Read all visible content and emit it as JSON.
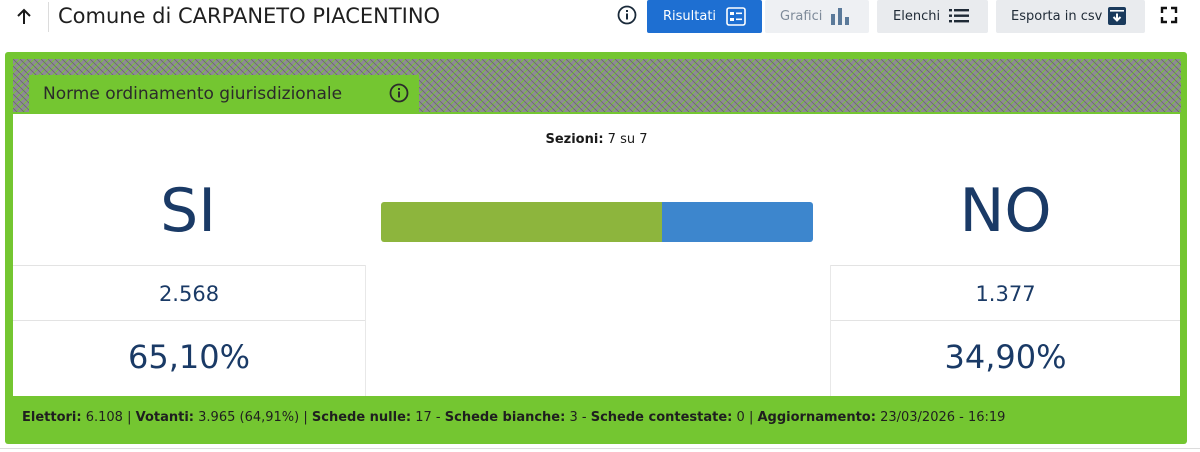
{
  "header": {
    "title": "Comune di CARPANETO PIACENTINO",
    "buttons": {
      "risultati": "Risultati",
      "grafici": "Grafici",
      "elenchi": "Elenchi",
      "esporta": "Esporta in csv"
    }
  },
  "section": {
    "title": "Norme ordinamento giurisdizionale"
  },
  "results": {
    "sezioni_label": "Sezioni:",
    "sezioni_value": "7 su 7",
    "si": {
      "label": "SI",
      "votes": "2.568",
      "percent": "65,10%",
      "share": 0.651
    },
    "no": {
      "label": "NO",
      "votes": "1.377",
      "percent": "34,90%",
      "share": 0.349
    }
  },
  "footer": {
    "elettori_label": "Elettori:",
    "elettori_value": "6.108",
    "votanti_label": "Votanti:",
    "votanti_value": "3.965 (64,91%)",
    "nulle_label": "Schede nulle:",
    "nulle_value": "17",
    "bianche_label": "Schede bianche:",
    "bianche_value": "3",
    "contestate_label": "Schede contestate:",
    "contestate_value": "0",
    "aggiornamento_label": "Aggiornamento:",
    "aggiornamento_value": "23/03/2026 - 16:19"
  },
  "colors": {
    "accent_green": "#74c631",
    "si_bar": "#8db53d",
    "no_bar": "#3d86cd",
    "primary_blue": "#1e6fd2",
    "text_navy": "#1a3a66"
  },
  "icons": {
    "back": "arrow-up-icon",
    "info": "info-circle-icon",
    "risultati": "list-card-icon",
    "grafici": "bar-chart-icon",
    "elenchi": "bullet-list-icon",
    "esporta": "download-box-icon",
    "expand": "fullscreen-icon"
  }
}
